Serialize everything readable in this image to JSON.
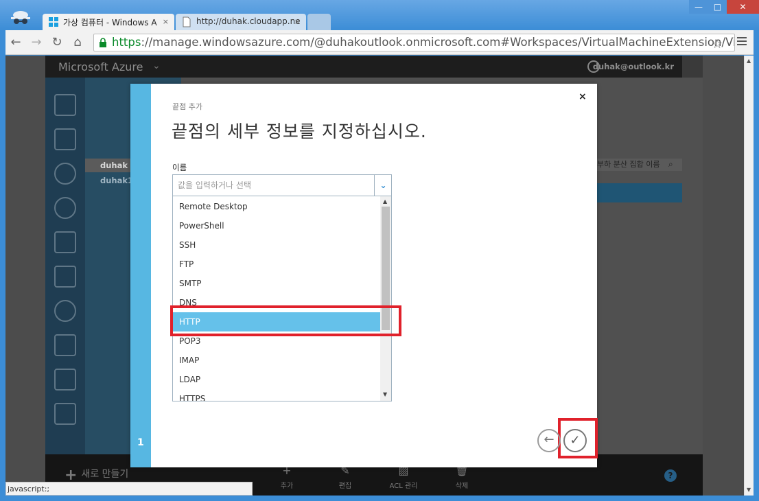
{
  "browser": {
    "tabs": [
      {
        "title": "가상 컴퓨터 - Windows A",
        "close": "×"
      },
      {
        "title": "http://duhak.cloudapp.ne",
        "close": "×"
      }
    ],
    "url_scheme": "https",
    "url_rest": "://manage.windowsazure.com/@duhakoutlook.onmicrosoft.com#Workspaces/VirtualMachineExtension/VirtualMach",
    "status_text": "javascript:;",
    "window_buttons": {
      "min": "—",
      "max": "□",
      "close": "✕"
    },
    "nav": {
      "back": "←",
      "forward": "→",
      "reload": "↻",
      "home": "⌂",
      "star": "☆"
    }
  },
  "portal": {
    "brand": "Microsoft Azure",
    "user": "duhak@outlook.kr",
    "sub_selected": "duhak",
    "sub_item": "duhak1",
    "search_placeholder": "부하 분산 집합 이름",
    "new_label": "새로 만들기",
    "commands": [
      {
        "label": "추가",
        "icon": "+"
      },
      {
        "label": "편집",
        "icon": "✎"
      },
      {
        "label": "ACL 관리",
        "icon": "▨"
      },
      {
        "label": "삭제",
        "icon": "🗑"
      }
    ],
    "help": "?"
  },
  "dialog": {
    "subtitle": "끝점 추가",
    "title": "끝점의 세부 정보를 지정하십시오.",
    "step": "1",
    "close": "×",
    "name_label": "이름",
    "name_placeholder": "값을 입력하거나 선택",
    "options": [
      "Remote Desktop",
      "PowerShell",
      "SSH",
      "FTP",
      "SMTP",
      "DNS",
      "HTTP",
      "POP3",
      "IMAP",
      "LDAP",
      "HTTPS"
    ],
    "highlighted_option": "HTTP",
    "back_icon": "←",
    "ok_icon": "✓",
    "colors": {
      "accent": "#57b7e2",
      "highlight": "#65c1ea",
      "callout": "#e0212b"
    }
  }
}
